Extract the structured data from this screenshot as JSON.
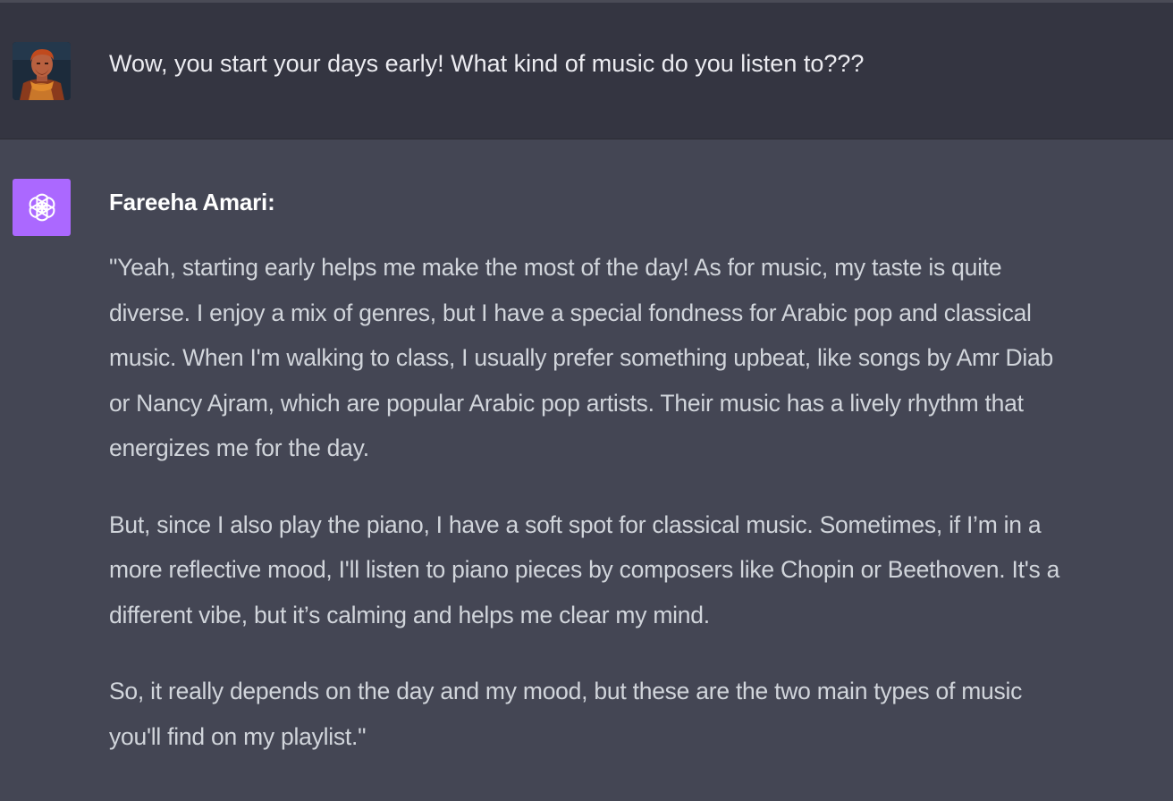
{
  "user_message": {
    "text": "Wow, you start your days early! What kind of music do you listen to???"
  },
  "assistant_message": {
    "speaker": "Fareeha Amari:",
    "paragraphs": [
      [
        "\"Yeah, starting early helps me make the most of the day! As for music, my taste is quite",
        "diverse. I enjoy a mix of genres, but I have a special fondness for Arabic pop and classical",
        "music. When I'm walking to class, I usually prefer something upbeat, like songs by Amr Diab",
        "or Nancy Ajram, which are popular Arabic pop artists. Their music has a lively rhythm that",
        "energizes me for the day."
      ],
      [
        "But, since I also play the piano, I have a soft spot for classical music. Sometimes, if I’m in a",
        "more reflective mood, I'll listen to piano pieces by composers like Chopin or Beethoven. It's a",
        "different vibe, but it’s calming and helps me clear my mind."
      ],
      [
        "So, it really depends on the day and my mood, but these are the two main types of music",
        "you'll find on my playlist.\""
      ]
    ]
  },
  "colors": {
    "user_row_bg": "#343541",
    "assistant_row_bg": "#444654",
    "assistant_avatar_bg": "#ab68ff"
  },
  "icons": {
    "user_avatar": "user-avatar-image",
    "assistant_avatar": "openai-logo-icon"
  }
}
